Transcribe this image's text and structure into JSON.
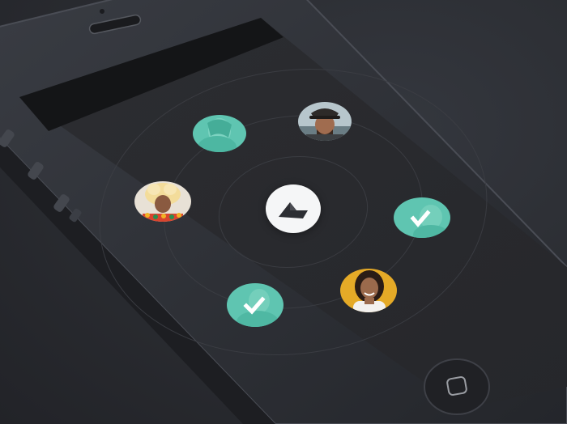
{
  "app": {
    "screen": "friend-selector",
    "accent_color": "#5ec4b0",
    "background_color": "#2a2b30"
  },
  "center_button": {
    "icon": "logo-icon"
  },
  "avatars": [
    {
      "id": "avatar-top-left",
      "state": "tinted"
    },
    {
      "id": "avatar-top-right",
      "state": "photo"
    },
    {
      "id": "avatar-left",
      "state": "photo"
    },
    {
      "id": "avatar-right",
      "state": "selected"
    },
    {
      "id": "avatar-bottom-left",
      "state": "selected"
    },
    {
      "id": "avatar-bottom-right",
      "state": "photo"
    }
  ],
  "device": {
    "home_button_icon": "home-square-icon"
  }
}
